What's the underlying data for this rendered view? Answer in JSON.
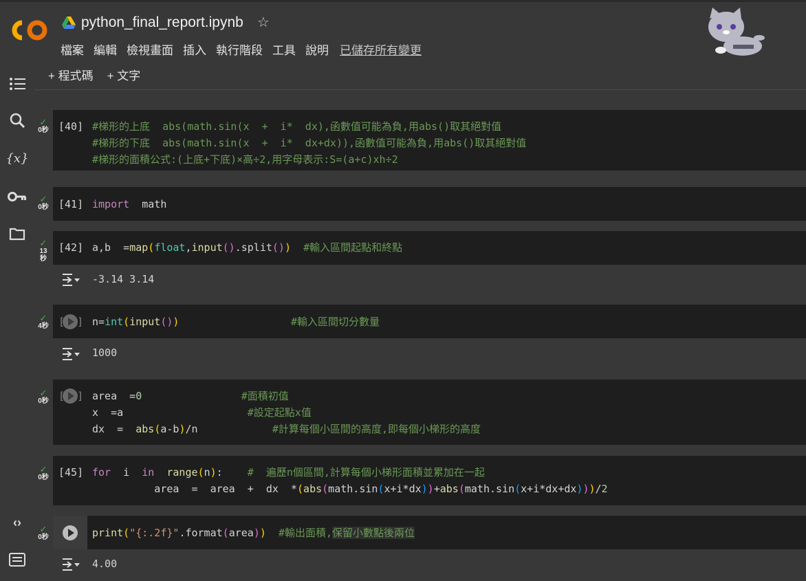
{
  "header": {
    "title": "python_final_report.ipynb",
    "menu": [
      "檔案",
      "編輯",
      "檢視畫面",
      "插入",
      "執行階段",
      "工具",
      "說明"
    ],
    "saved_status": "已儲存所有變更",
    "logo_text": "CO"
  },
  "toolbar": {
    "add_code": "+ 程式碼",
    "add_text": "+ 文字"
  },
  "cells": [
    {
      "prompt": "[40]",
      "time": "0秒"
    },
    {
      "prompt": "[41]",
      "time": "0秒"
    },
    {
      "prompt": "[42]",
      "time": "13秒",
      "output": "-3.14 3.14"
    },
    {
      "prompt": "[43]",
      "time": "4秒",
      "output": "1000"
    },
    {
      "prompt": "[44]",
      "time": "0秒"
    },
    {
      "prompt": "[45]",
      "time": "0秒"
    },
    {
      "prompt": "",
      "time": "0秒",
      "output": "4.00"
    }
  ],
  "colors": {
    "background": "#383838",
    "code_background": "#1e1e1e",
    "check": "#38b44a",
    "comment": "#6a9955",
    "keyword": "#c586c0"
  }
}
